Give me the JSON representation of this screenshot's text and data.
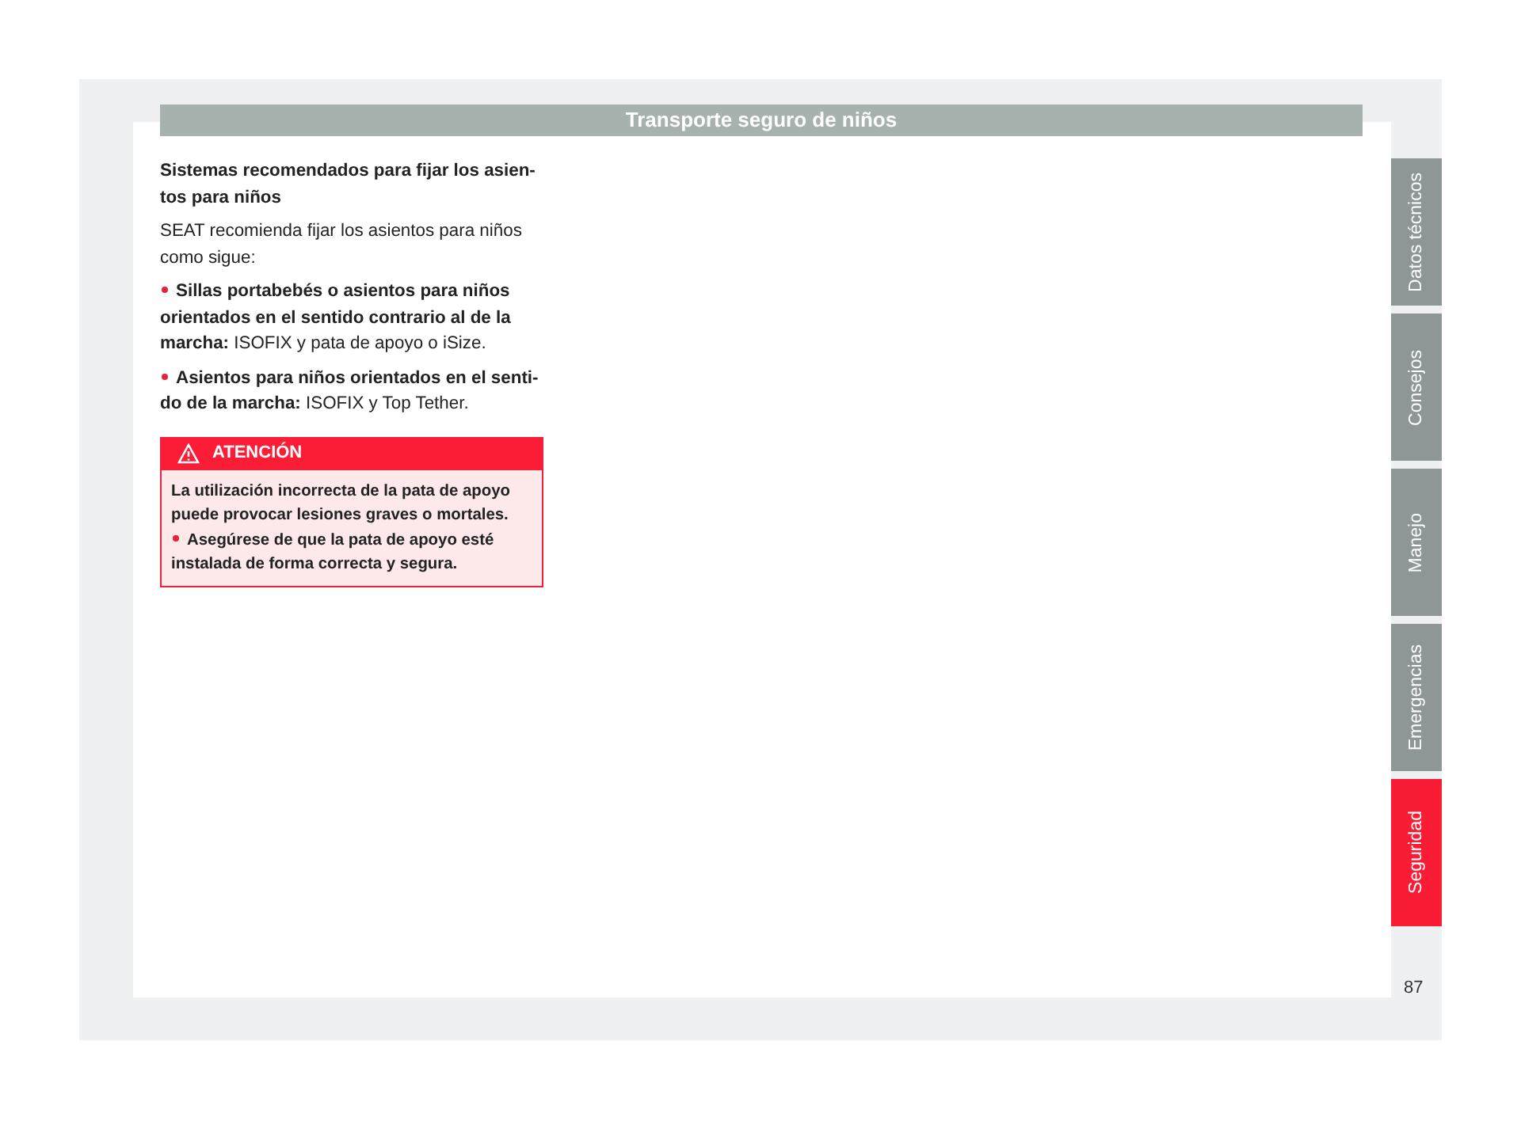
{
  "header": {
    "title": "Transporte seguro de niños"
  },
  "content": {
    "heading": "Sistemas recomendados para fijar los asien-\ntos para niños",
    "intro": "SEAT recomienda fijar los asientos para niños\ncomo sigue:",
    "bullets": [
      "**Sillas portabebés o asientos para niños\norientados en el sentido contrario al de la\nmarcha:** ISOFIX y pata de apoyo o iSize.",
      "**Asientos para niños orientados en el senti-\ndo de la marcha:** ISOFIX y Top Tether."
    ],
    "warning": {
      "title": "ATENCIÓN",
      "text": "La utilización incorrecta de la pata de apoyo\npuede provocar lesiones graves o mortales.",
      "bullets": [
        "Asegúrese de que la pata de apoyo esté\ninstalada de forma correcta y segura."
      ]
    }
  },
  "side_tabs": [
    {
      "label": "Datos técnicos",
      "selected": false
    },
    {
      "label": "Consejos",
      "selected": false
    },
    {
      "label": "Manejo",
      "selected": false
    },
    {
      "label": "Emergencias",
      "selected": false
    },
    {
      "label": "Seguridad",
      "selected": true
    }
  ],
  "page_number": "87"
}
